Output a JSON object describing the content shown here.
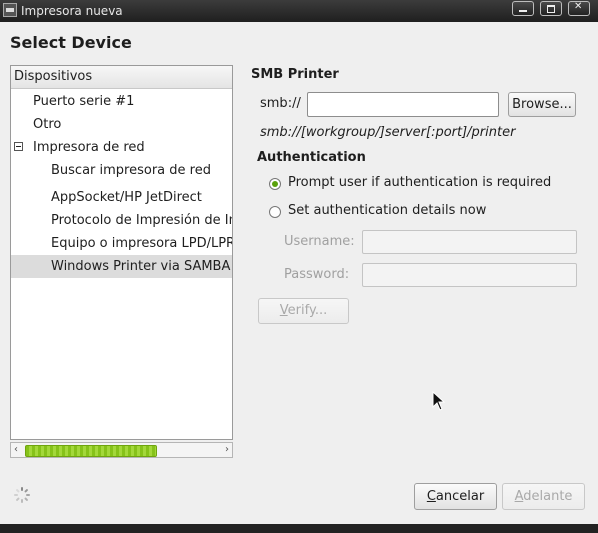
{
  "window": {
    "title": "Impresora nueva"
  },
  "heading": "Select Device",
  "devices": {
    "header": "Dispositivos",
    "items": [
      {
        "label": "Puerto serie #1",
        "level": 1,
        "selected": false,
        "expander": false
      },
      {
        "label": "Otro",
        "level": 1,
        "selected": false,
        "expander": false
      },
      {
        "label": "Impresora de red",
        "level": 1,
        "selected": false,
        "expander": true
      },
      {
        "label": "Buscar impresora de red",
        "level": 2,
        "selected": false,
        "expander": false
      },
      {
        "label": "AppSocket/HP JetDirect",
        "level": 2,
        "selected": false,
        "expander": false
      },
      {
        "label": "Protocolo de Impresión de Internet (IPP)",
        "level": 2,
        "selected": false,
        "expander": false
      },
      {
        "label": "Equipo o impresora LPD/LPR",
        "level": 2,
        "selected": false,
        "expander": false
      },
      {
        "label": "Windows Printer via SAMBA",
        "level": 2,
        "selected": true,
        "expander": false
      }
    ]
  },
  "smb": {
    "title": "SMB Printer",
    "prefix": "smb://",
    "url_value": "",
    "browse_label": "Browse...",
    "hint": "smb://[workgroup/]server[:port]/printer"
  },
  "auth": {
    "title": "Authentication",
    "options": [
      {
        "label": "Prompt user if authentication is required",
        "checked": true
      },
      {
        "label": "Set authentication details now",
        "checked": false
      }
    ],
    "username_label": "Username:",
    "password_label": "Password:",
    "verify_label": "Verify..."
  },
  "footer": {
    "cancel_label": "Cancelar",
    "forward_label": "Adelante"
  }
}
